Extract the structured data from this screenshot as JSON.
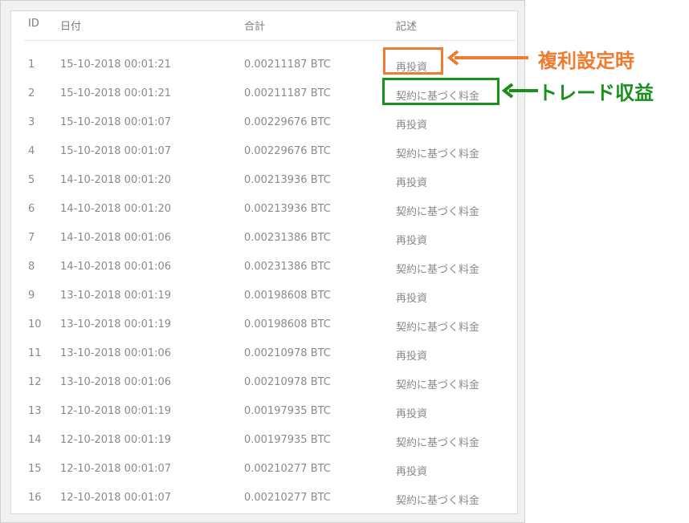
{
  "table": {
    "headers": {
      "id": "ID",
      "date": "日付",
      "total": "合計",
      "description": "記述"
    },
    "rows": [
      {
        "id": "1",
        "date": "15-10-2018 00:01:21",
        "total": "0.00211187 BTC",
        "description": "再投資"
      },
      {
        "id": "2",
        "date": "15-10-2018 00:01:21",
        "total": "0.00211187 BTC",
        "description": "契約に基づく料金"
      },
      {
        "id": "3",
        "date": "15-10-2018 00:01:07",
        "total": "0.00229676 BTC",
        "description": "再投資"
      },
      {
        "id": "4",
        "date": "15-10-2018 00:01:07",
        "total": "0.00229676 BTC",
        "description": "契約に基づく料金"
      },
      {
        "id": "5",
        "date": "14-10-2018 00:01:20",
        "total": "0.00213936 BTC",
        "description": "再投資"
      },
      {
        "id": "6",
        "date": "14-10-2018 00:01:20",
        "total": "0.00213936 BTC",
        "description": "契約に基づく料金"
      },
      {
        "id": "7",
        "date": "14-10-2018 00:01:06",
        "total": "0.00231386 BTC",
        "description": "再投資"
      },
      {
        "id": "8",
        "date": "14-10-2018 00:01:06",
        "total": "0.00231386 BTC",
        "description": "契約に基づく料金"
      },
      {
        "id": "9",
        "date": "13-10-2018 00:01:19",
        "total": "0.00198608 BTC",
        "description": "再投資"
      },
      {
        "id": "10",
        "date": "13-10-2018 00:01:19",
        "total": "0.00198608 BTC",
        "description": "契約に基づく料金"
      },
      {
        "id": "11",
        "date": "13-10-2018 00:01:06",
        "total": "0.00210978 BTC",
        "description": "再投資"
      },
      {
        "id": "12",
        "date": "13-10-2018 00:01:06",
        "total": "0.00210978 BTC",
        "description": "契約に基づく料金"
      },
      {
        "id": "13",
        "date": "12-10-2018 00:01:19",
        "total": "0.00197935 BTC",
        "description": "再投資"
      },
      {
        "id": "14",
        "date": "12-10-2018 00:01:19",
        "total": "0.00197935 BTC",
        "description": "契約に基づく料金"
      },
      {
        "id": "15",
        "date": "12-10-2018 00:01:07",
        "total": "0.00210277 BTC",
        "description": "再投資"
      },
      {
        "id": "16",
        "date": "12-10-2018 00:01:07",
        "total": "0.00210277 BTC",
        "description": "契約に基づく料金"
      }
    ]
  },
  "annotations": {
    "compound": {
      "label": "複利設定時",
      "color": "#f07a2d"
    },
    "trade": {
      "label": "トレード収益",
      "color": "#18901b"
    }
  }
}
